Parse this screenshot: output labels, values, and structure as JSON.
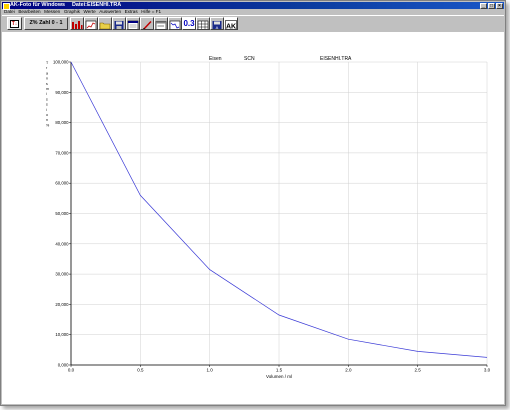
{
  "window": {
    "app_title": "AK-Foto für Windows",
    "file_title": "Datei:EISENHI.TRA",
    "buttons": [
      "_",
      "□",
      "×"
    ]
  },
  "menu": [
    "Datei",
    "Bearbeiten",
    "Messen",
    "Graphik",
    "Werte",
    "Auswerten",
    "Extras",
    "Hilfe = F1"
  ],
  "toolbar": {
    "logo_text": "T↓",
    "zahl_label": "Z% Zahl 0 - 1",
    "zoom_label": "0.3",
    "ak_label": "AK",
    "icons": [
      "logo-icon",
      "bars-icon",
      "chart-icon",
      "open-folder-icon",
      "save-disk-icon",
      "dialog-icon",
      "pen-icon",
      "window-icon",
      "grid-icon",
      "layout-icon",
      "disk-icon",
      "ak-icon"
    ]
  },
  "chart_header": {
    "substance": "Eisen",
    "reagent": "SCN",
    "file": "EISENHI.TRA"
  },
  "chart_data": {
    "type": "line",
    "ylabel": "T r a n s m i s s i o n  %",
    "xlabel": "Volumen / ml",
    "xlim": [
      0.0,
      3.0
    ],
    "ylim": [
      0,
      100000
    ],
    "x_ticks": [
      "0.0",
      "0.5",
      "1.0",
      "1.5",
      "2.0",
      "2.5",
      "3.0"
    ],
    "y_ticks": [
      "0,000",
      "10,000",
      "20,000",
      "30,000",
      "40,000",
      "50,000",
      "60,000",
      "70,000",
      "80,000",
      "90,000",
      "100,000"
    ],
    "grid": true,
    "line_color": "#3a3ad6",
    "series": [
      {
        "x": [
          0.0,
          0.5,
          1.0,
          1.5,
          2.0,
          2.5,
          3.0
        ],
        "y": [
          100000,
          56000,
          31500,
          16500,
          8500,
          4500,
          2500
        ]
      }
    ]
  }
}
